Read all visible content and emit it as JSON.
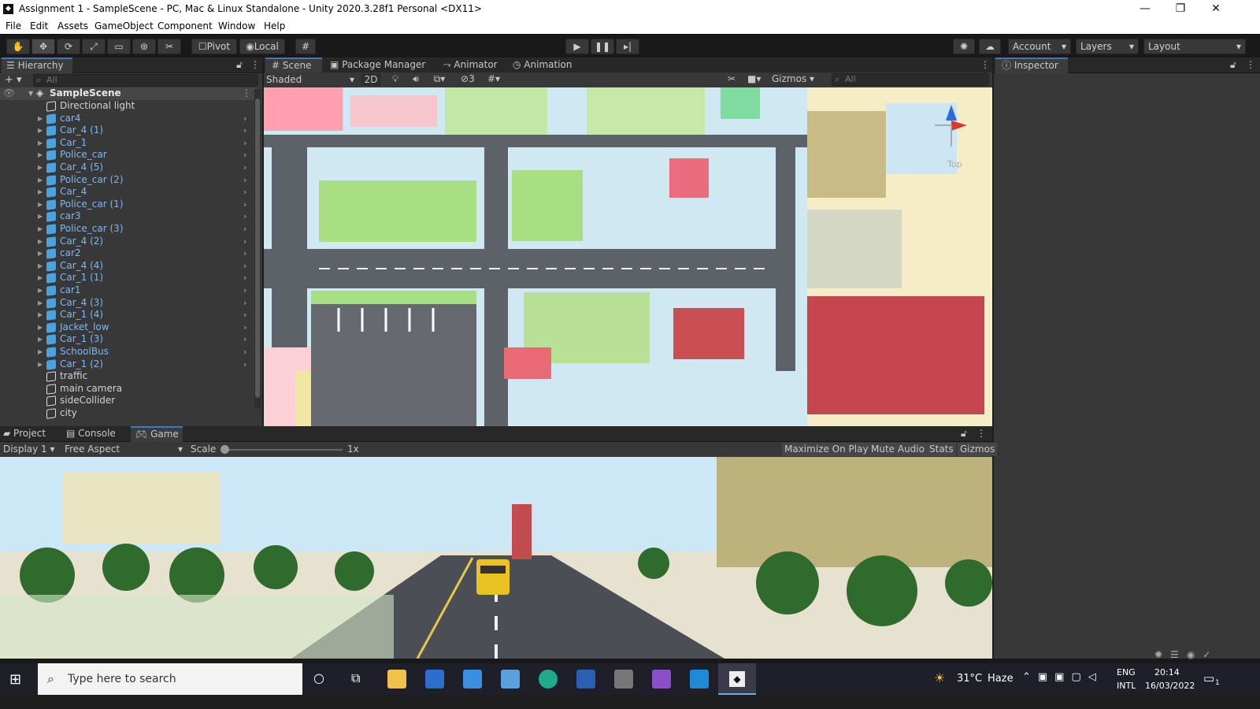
{
  "window": {
    "title": "Assignment 1 - SampleScene - PC, Mac & Linux Standalone - Unity 2020.3.28f1 Personal <DX11>",
    "minimize": "—",
    "maximize": "❐",
    "close": "✕"
  },
  "menu": [
    "File",
    "Edit",
    "Assets",
    "GameObject",
    "Component",
    "Window",
    "Help"
  ],
  "toolbar": {
    "pivot": "Pivot",
    "local": "Local",
    "account": "Account",
    "layers": "Layers",
    "layout": "Layout"
  },
  "hierarchy": {
    "tab": "Hierarchy",
    "search_placeholder": "All",
    "scene": "SampleScene",
    "items": [
      {
        "label": "Directional light",
        "prefab": false,
        "expandable": false
      },
      {
        "label": "car4",
        "prefab": true,
        "expandable": true
      },
      {
        "label": "Car_4 (1)",
        "prefab": true,
        "expandable": true
      },
      {
        "label": "Car_1",
        "prefab": true,
        "expandable": true
      },
      {
        "label": "Police_car",
        "prefab": true,
        "expandable": true
      },
      {
        "label": "Car_4 (5)",
        "prefab": true,
        "expandable": true
      },
      {
        "label": "Police_car (2)",
        "prefab": true,
        "expandable": true
      },
      {
        "label": "Car_4",
        "prefab": true,
        "expandable": true
      },
      {
        "label": "Police_car (1)",
        "prefab": true,
        "expandable": true
      },
      {
        "label": "car3",
        "prefab": true,
        "expandable": true
      },
      {
        "label": "Police_car (3)",
        "prefab": true,
        "expandable": true
      },
      {
        "label": "Car_4 (2)",
        "prefab": true,
        "expandable": true
      },
      {
        "label": "car2",
        "prefab": true,
        "expandable": true
      },
      {
        "label": "Car_4 (4)",
        "prefab": true,
        "expandable": true
      },
      {
        "label": "Car_1 (1)",
        "prefab": true,
        "expandable": true
      },
      {
        "label": "car1",
        "prefab": true,
        "expandable": true
      },
      {
        "label": "Car_4 (3)",
        "prefab": true,
        "expandable": true
      },
      {
        "label": "Car_1 (4)",
        "prefab": true,
        "expandable": true
      },
      {
        "label": "Jacket_low",
        "prefab": true,
        "expandable": true
      },
      {
        "label": "Car_1 (3)",
        "prefab": true,
        "expandable": true
      },
      {
        "label": "SchoolBus",
        "prefab": true,
        "expandable": true
      },
      {
        "label": "Car_1 (2)",
        "prefab": true,
        "expandable": true
      },
      {
        "label": "traffic",
        "prefab": false,
        "expandable": false
      },
      {
        "label": "main camera",
        "prefab": false,
        "expandable": false
      },
      {
        "label": "sideCollider",
        "prefab": false,
        "expandable": false
      },
      {
        "label": "city",
        "prefab": false,
        "expandable": false
      }
    ]
  },
  "scene_tabs": [
    "Scene",
    "Package Manager",
    "Animator",
    "Animation"
  ],
  "scene_toolbar": {
    "shading": "Shaded",
    "mode2d": "2D",
    "hidden_count": "3",
    "gizmos": "Gizmos",
    "search_placeholder": "All",
    "gizmo_label": "Top"
  },
  "inspector": {
    "tab": "Inspector"
  },
  "bottom_tabs": [
    "Project",
    "Console",
    "Game"
  ],
  "game_toolbar": {
    "display": "Display 1",
    "aspect": "Free Aspect",
    "scale_label": "Scale",
    "scale_value": "1x",
    "maximize": "Maximize On Play",
    "mute": "Mute Audio",
    "stats": "Stats",
    "gizmos": "Gizmos"
  },
  "taskbar": {
    "search_placeholder": "Type here to search",
    "weather_temp": "31°C",
    "weather_desc": "Haze",
    "lang1": "ENG",
    "lang2": "INTL",
    "time": "20:14",
    "date": "16/03/2022",
    "notif_count": "1"
  },
  "colors": {
    "accent": "#3a79bb",
    "prefab": "#7cb8f4",
    "panel": "#383838"
  }
}
